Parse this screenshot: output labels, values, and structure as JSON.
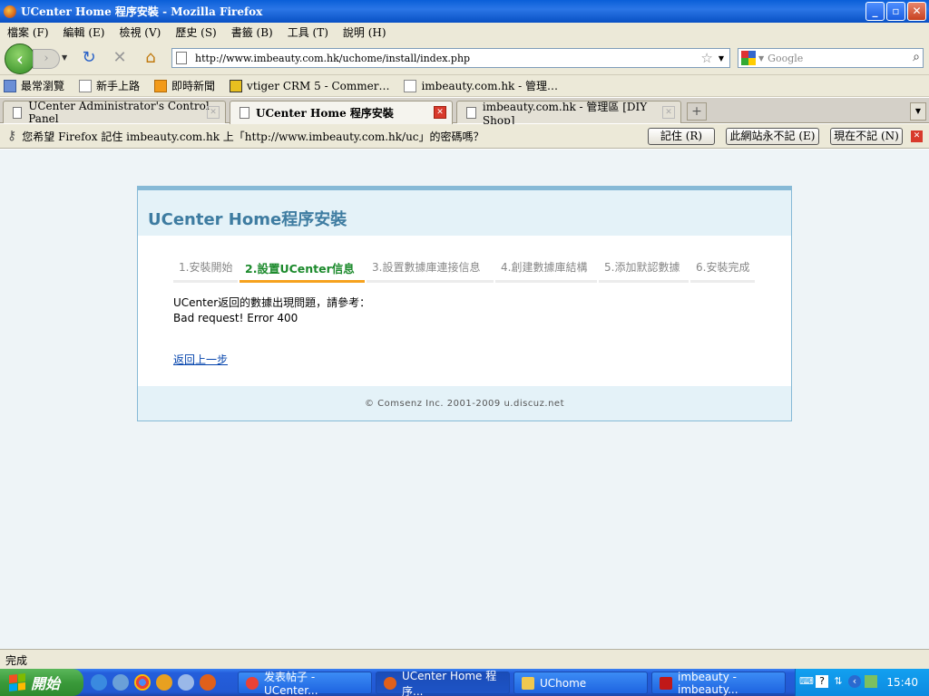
{
  "window": {
    "title": "UCenter Home 程序安裝 - Mozilla Firefox",
    "buttons": [
      "_",
      "▫",
      "✕"
    ]
  },
  "menu": [
    "檔案 (F)",
    "編輯 (E)",
    "檢視 (V)",
    "歷史 (S)",
    "書籤 (B)",
    "工具 (T)",
    "說明 (H)"
  ],
  "address": {
    "url": "http://www.imbeauty.com.hk/uchome/install/index.php",
    "search_placeholder": "Google"
  },
  "bookmarks": [
    "最常瀏覽",
    "新手上路",
    "即時新聞",
    "vtiger CRM 5 - Commer…",
    "imbeauty.com.hk - 管理…"
  ],
  "tabs": [
    {
      "label": "UCenter Administrator's Control Panel",
      "active": false
    },
    {
      "label": "UCenter Home 程序安裝",
      "active": true
    },
    {
      "label": "imbeauty.com.hk - 管理區 [DIY Shop]",
      "active": false
    }
  ],
  "notification": {
    "message": "您希望 Firefox 記住 imbeauty.com.hk 上「http://www.imbeauty.com.hk/uc」的密碼嗎？",
    "remember": "記住 (R)",
    "never": "此網站永不記 (E)",
    "not_now": "現在不記 (N)"
  },
  "page": {
    "heading": "UCenter Home程序安裝",
    "steps": [
      "1.安裝開始",
      "2.設置UCenter信息",
      "3.設置數據庫連接信息",
      "4.創建數據庫結構",
      "5.添加默認數據",
      "6.安裝完成"
    ],
    "current_step": 2,
    "message_line1": "UCenter返回的數據出現問題，請參考：",
    "message_line2": "Bad request! Error 400",
    "back_link": "返回上一步",
    "footer": "© Comsenz Inc. 2001-2009 u.discuz.net"
  },
  "status": "完成",
  "taskbar": {
    "start": "開始",
    "tasks": [
      "发表帖子 - UCenter...",
      "UCenter Home 程序...",
      "UChome",
      "imbeauty - imbeauty..."
    ],
    "clock": "15:40"
  }
}
